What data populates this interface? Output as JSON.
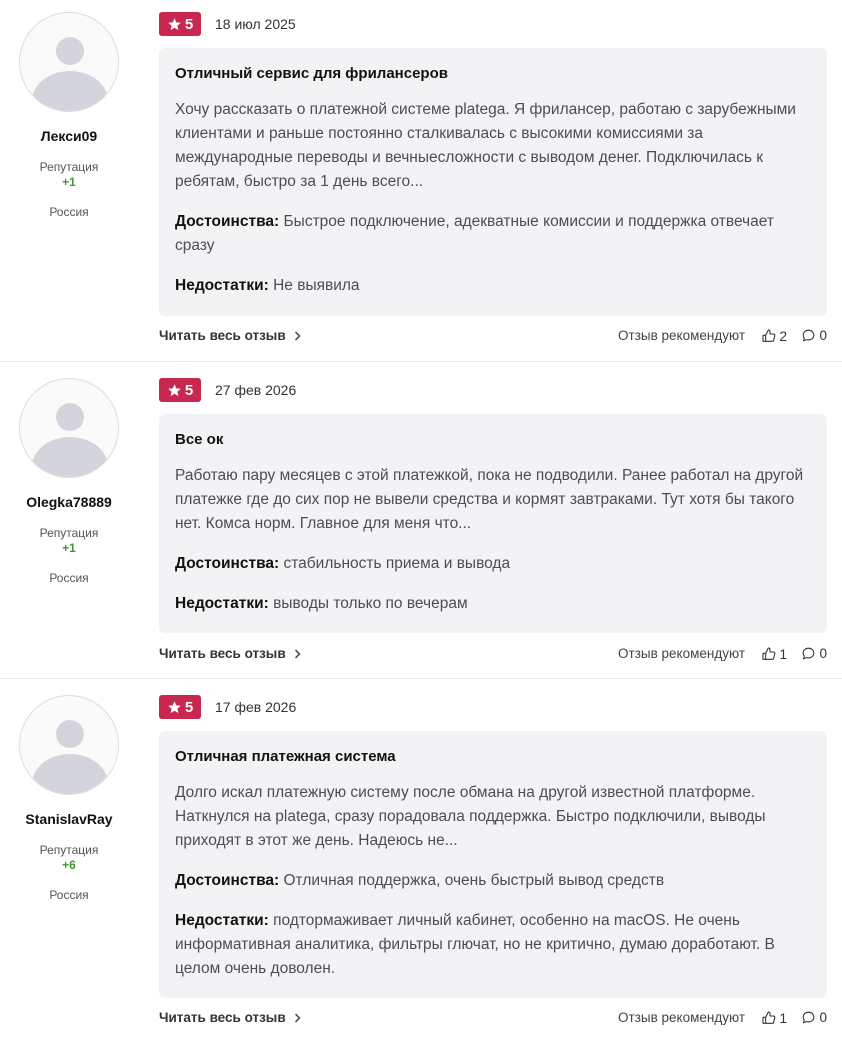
{
  "reviews": [
    {
      "author": {
        "name": "Лекси09",
        "reputation_label": "Репутация",
        "reputation_value": "+1",
        "country": "Россия"
      },
      "rating": "5",
      "date": "18 июл 2025",
      "title": "Отличный сервис для фрилансеров",
      "body": "Хочу рассказать о платежной системе plategа. Я фрилансер, работаю с зарубежными клиентами и раньше постоянно сталкивалась с высокими комиссиями за международные переводы и вечныесложности с выводом денег. Подключилась к ребятам, быстро за 1 день всего...",
      "pros_label": "Достоинства:",
      "pros": "Быстрое подключение, адекватные комиссии и поддержка отвечает сразу",
      "cons_label": "Недостатки:",
      "cons": "Не выявила",
      "read_more": "Читать весь отзыв",
      "recommend_label": "Отзыв рекомендуют",
      "likes": "2",
      "comments": "0"
    },
    {
      "author": {
        "name": "Olegka78889",
        "reputation_label": "Репутация",
        "reputation_value": "+1",
        "country": "Россия"
      },
      "rating": "5",
      "date": "27 фев 2026",
      "title": "Все ок",
      "body": "Работаю пару месяцев с этой платежкой, пока не подводили. Ранее работал на другой платежке где до сих пор не вывели средства и кормят завтраками. Тут хотя бы такого нет. Комса норм. Главное для меня что...",
      "pros_label": "Достоинства:",
      "pros": "стабильность приема и вывода",
      "cons_label": "Недостатки:",
      "cons": "выводы только по вечерам",
      "read_more": "Читать весь отзыв",
      "recommend_label": "Отзыв рекомендуют",
      "likes": "1",
      "comments": "0"
    },
    {
      "author": {
        "name": "StanislavRay",
        "reputation_label": "Репутация",
        "reputation_value": "+6",
        "country": "Россия"
      },
      "rating": "5",
      "date": "17 фев 2026",
      "title": "Отличная платежная система",
      "body": "Долго искал платежную систему после обмана на другой известной платформе. Наткнулся на plategа, сразу порадовала поддержка. Быстро подключили, выводы приходят в этот же день. Надеюсь не...",
      "pros_label": "Достоинства:",
      "pros": "Отличная поддержка, очень быстрый вывод средств",
      "cons_label": "Недостатки:",
      "cons": "подтормаживает личный кабинет, особенно на macOS. Не очень информативная аналитика, фильтры глючат, но не критично, думаю доработают. В целом очень доволен.",
      "read_more": "Читать весь отзыв",
      "recommend_label": "Отзыв рекомендуют",
      "likes": "1",
      "comments": "0"
    }
  ],
  "colors": {
    "badge": "#c8284e",
    "card_bg": "#f3f3f5",
    "reputation": "#3c9a2e"
  },
  "icons": {
    "rating": "star-icon",
    "read_more": "chevron-right-icon",
    "likes": "thumbs-up-icon",
    "comments": "comment-icon",
    "avatar": "user-placeholder-icon"
  }
}
